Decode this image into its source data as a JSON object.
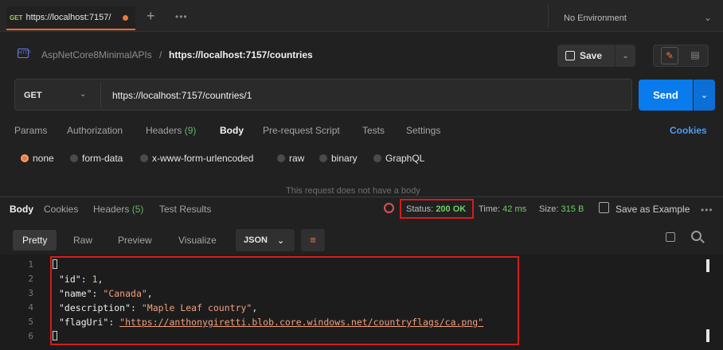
{
  "tabbar": {
    "active_tab": {
      "method": "GET",
      "url": "https://localhost:7157/",
      "unsaved": true
    },
    "new_tab": "+",
    "more": "•••",
    "environment": "No Environment"
  },
  "breadcrumb": {
    "collection": "AspNetCore8MinimalAPIs",
    "separator": "/",
    "request": "https://localhost:7157/countries",
    "save_label": "Save"
  },
  "request": {
    "method": "GET",
    "url": "https://localhost:7157/countries/1",
    "send_label": "Send",
    "tabs": [
      {
        "label": "Params"
      },
      {
        "label": "Authorization"
      },
      {
        "label": "Headers",
        "count": "(9)"
      },
      {
        "label": "Body"
      },
      {
        "label": "Pre-request Script"
      },
      {
        "label": "Tests"
      },
      {
        "label": "Settings"
      }
    ],
    "active_tab": "Body",
    "cookies_label": "Cookies",
    "body_types": [
      "none",
      "form-data",
      "x-www-form-urlencoded",
      "raw",
      "binary",
      "GraphQL"
    ],
    "selected_body_type": "none",
    "no_body_message": "This request does not have a body"
  },
  "response": {
    "tabs": [
      {
        "label": "Body"
      },
      {
        "label": "Cookies"
      },
      {
        "label": "Headers",
        "count": "(5)"
      },
      {
        "label": "Test Results"
      }
    ],
    "status_label": "Status:",
    "status_value": "200 OK",
    "time_label": "Time:",
    "time_value": "42 ms",
    "size_label": "Size:",
    "size_value": "315 B",
    "save_example_label": "Save as Example",
    "more": "•••",
    "view_tabs": [
      "Pretty",
      "Raw",
      "Preview",
      "Visualize"
    ],
    "format": "JSON",
    "code": {
      "line_numbers": [
        "1",
        "2",
        "3",
        "4",
        "5",
        "6"
      ],
      "lines": {
        "l2_key": "\"id\"",
        "l2_val": "1",
        "l3_key": "\"name\"",
        "l3_val": "\"Canada\"",
        "l4_key": "\"description\"",
        "l4_val": "\"Maple Leaf country\"",
        "l5_key": "\"flagUri\"",
        "l5_val": "\"https://anthonygiretti.blob.core.windows.net/countryflags/ca.png\""
      }
    }
  },
  "colors": {
    "accent": "#e87a3c",
    "send": "#097bed",
    "success": "#6fcf66",
    "highlight_box": "#d61c1c"
  }
}
